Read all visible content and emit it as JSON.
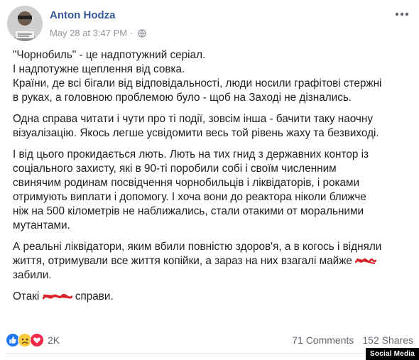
{
  "post": {
    "author": "Anton Hodza",
    "timestamp": "May 28 at 3:47 PM",
    "separator": "·",
    "paragraphs": [
      [
        "\"Чорнобиль\" - це надпотужний серіал.",
        "І надпотужне щеплення від совка.",
        "Країни, де всі бігали від відповідальності, люди носили графітові стержні",
        "в руках, а головною проблемою було - щоб на Заході не дізнались."
      ],
      [
        "Одна справа читати і чути про ті події, зовсім інша - бачити таку наочну",
        "візуалізацію. Якось легше усвідомити весь той рівень жаху та безвиході."
      ],
      [
        "І від цього прокидається лють. Лють на тих гнид з державних контор із",
        "соціального захисту, які в 90-ті поробили собі і своїм численним",
        "свинячим родинам посвідчення чорнобильців і ліквідаторів, і роками",
        "отримують виплати і допомогу. І хоча вони до реактора ніколи ближче",
        "ніж на 500 кілометрів не наближались, стали отакими от моральними",
        "мутантами."
      ],
      [
        "А реальні ліквідатори, яким вбили повністю здоров'я, а в когось і відняли",
        "життя, отримували все життя копійки, а зараз на них взагалі майже",
        "забили."
      ]
    ],
    "last_prefix": "Отакі",
    "last_suffix": "справи."
  },
  "reactions": {
    "count": "2K",
    "icons": [
      "like-icon",
      "sad-icon",
      "love-icon"
    ],
    "colors": {
      "like": "#2078f4",
      "sad": "#f7c93b",
      "love": "#f0284a"
    }
  },
  "stats": {
    "comments": "71 Comments",
    "shares": "152 Shares"
  },
  "watermark": "Social Media",
  "colors": {
    "author": "#365899",
    "meta": "#90949c",
    "text": "#1c1e21",
    "scribble": "#d9222a"
  }
}
